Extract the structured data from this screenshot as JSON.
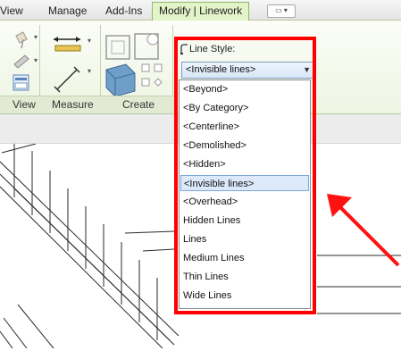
{
  "tabs": [
    {
      "label": "View"
    },
    {
      "label": "Manage"
    },
    {
      "label": "Add-Ins"
    },
    {
      "label": "Modify | Linework",
      "active": true
    }
  ],
  "panels": {
    "view_label": "View",
    "measure_label": "Measure",
    "create_label": "Create"
  },
  "line_style": {
    "label": "Line Style:",
    "selected": "<Invisible lines>",
    "options": [
      "<Beyond>",
      "<By Category>",
      "<Centerline>",
      "<Demolished>",
      "<Hidden>",
      "<Invisible lines>",
      "<Overhead>",
      "Hidden Lines",
      "Lines",
      "Medium Lines",
      "Thin Lines",
      "Wide Lines"
    ]
  },
  "colors": {
    "highlight": "#ff0000",
    "ribbon_active_tab": "#e4f4c9",
    "selected_option": "#dbe9fb"
  },
  "icons": [
    "paint-icon",
    "measure-between-icon",
    "measure-along-icon",
    "create-similar-icon",
    "create-group-icon",
    "line-style-icon",
    "arrow-annotation"
  ]
}
